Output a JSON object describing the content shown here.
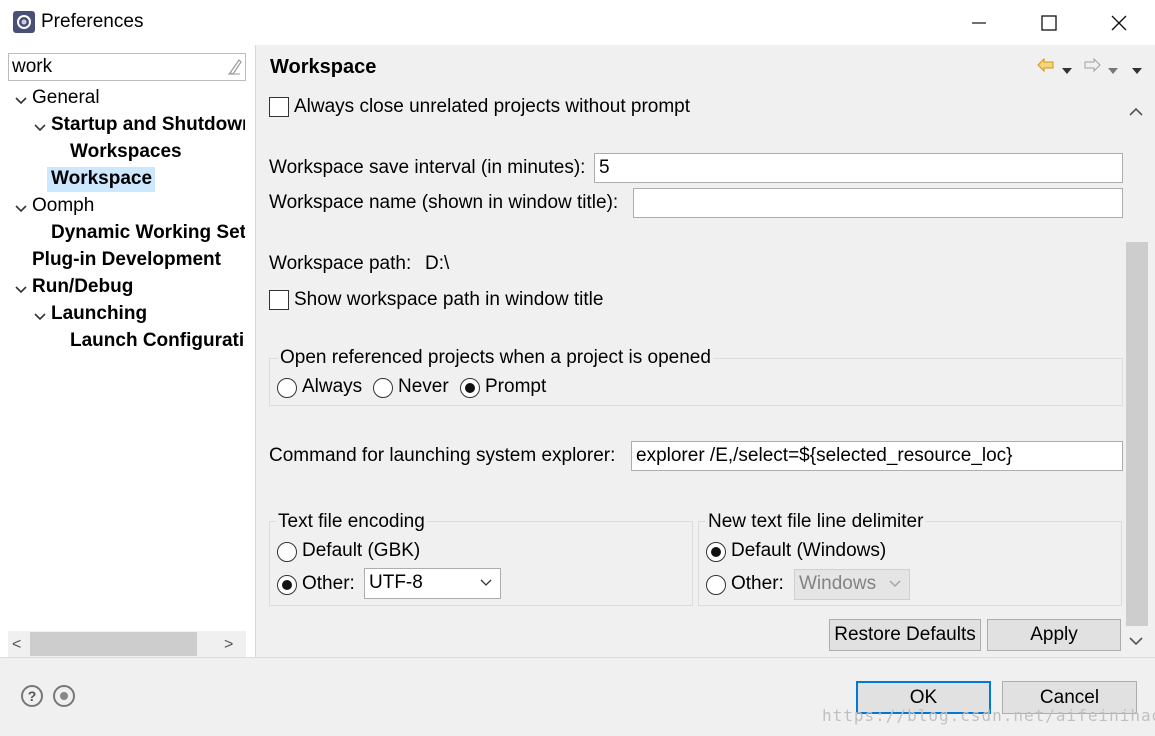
{
  "window": {
    "title": "Preferences",
    "controls": {
      "minimize": "minimize",
      "maximize": "maximize",
      "close": "close"
    }
  },
  "filter": {
    "value": "work"
  },
  "tree": {
    "items": [
      {
        "label": "General",
        "level": 0,
        "expanded": true,
        "bold": false
      },
      {
        "label": "Startup and Shutdown",
        "level": 1,
        "expanded": true,
        "bold": true
      },
      {
        "label": "Workspaces",
        "level": 2,
        "expanded": null,
        "bold": true
      },
      {
        "label": "Workspace",
        "level": 1,
        "expanded": null,
        "bold": true,
        "selected": true
      },
      {
        "label": "Oomph",
        "level": 0,
        "expanded": true,
        "bold": false
      },
      {
        "label": "Dynamic Working Sets",
        "level": 1,
        "expanded": null,
        "bold": true
      },
      {
        "label": "Plug-in Development",
        "level": 0,
        "expanded": null,
        "bold": true
      },
      {
        "label": "Run/Debug",
        "level": 0,
        "expanded": true,
        "bold": true
      },
      {
        "label": "Launching",
        "level": 1,
        "expanded": true,
        "bold": true
      },
      {
        "label": "Launch Configurations",
        "level": 2,
        "expanded": null,
        "bold": true
      }
    ],
    "scroll_left": "<",
    "scroll_right": ">"
  },
  "page": {
    "title": "Workspace",
    "always_close_label": "Always close unrelated projects without prompt",
    "always_close_checked": false,
    "save_interval_label": "Workspace save interval (in minutes):",
    "save_interval_value": "5",
    "name_label": "Workspace name (shown in window title):",
    "name_value": "",
    "path_label": "Workspace path:",
    "path_value": "D:\\",
    "show_path_label": "Show workspace path in window title",
    "show_path_checked": false,
    "open_ref_group": {
      "title": "Open referenced projects when a project is opened",
      "options": [
        "Always",
        "Never",
        "Prompt"
      ],
      "selected": "Prompt"
    },
    "explorer_label": "Command for launching system explorer:",
    "explorer_value": "explorer /E,/select=${selected_resource_loc}",
    "encoding_group": {
      "title": "Text file encoding",
      "default_label": "Default (GBK)",
      "other_label": "Other:",
      "selected": "Other",
      "other_value": "UTF-8"
    },
    "delimiter_group": {
      "title": "New text file line delimiter",
      "default_label": "Default (Windows)",
      "other_label": "Other:",
      "selected": "Default",
      "other_value": "Windows"
    },
    "restore_defaults": "Restore Defaults",
    "apply": "Apply"
  },
  "footer": {
    "ok": "OK",
    "cancel": "Cancel",
    "help_glyph": "?"
  },
  "watermark": "https://blog.csdn.net/aifeinihao",
  "colors": {
    "selection": "#cce8ff",
    "default_button_border": "#0078d7",
    "nav_back": "#e0a800"
  }
}
